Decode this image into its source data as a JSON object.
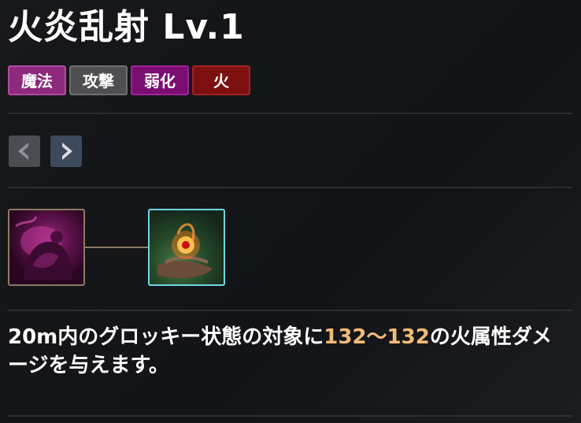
{
  "skill": {
    "title": "火炎乱射 Lv.1",
    "tags": [
      {
        "label": "魔法",
        "color": "#8e2a7e"
      },
      {
        "label": "攻撃",
        "color": "#4f4f52"
      },
      {
        "label": "弱化",
        "color": "#7a0e72"
      },
      {
        "label": "火",
        "color": "#7d1010"
      }
    ],
    "nav": {
      "prev_icon": "chevron-left-icon",
      "next_icon": "chevron-right-icon"
    },
    "icons": [
      {
        "name": "dark-creature-skill-icon"
      },
      {
        "name": "fire-in-hand-skill-icon"
      }
    ],
    "description": {
      "part1": "20m内のグロッキー状態の対象に",
      "damage": "132〜132",
      "part2": "の火属性ダメージを与えます。"
    },
    "highlight_color": "#f2bb77"
  }
}
